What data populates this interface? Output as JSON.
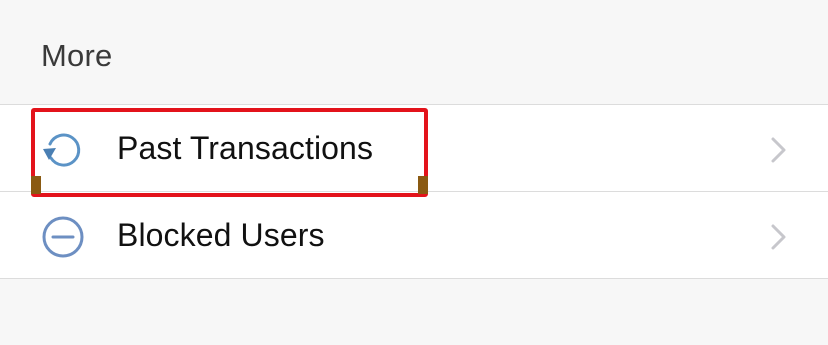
{
  "section": {
    "title": "More"
  },
  "items": [
    {
      "label": "Past Transactions",
      "icon": "history-icon"
    },
    {
      "label": "Blocked Users",
      "icon": "blocked-icon"
    }
  ],
  "colors": {
    "background": "#f7f7f7",
    "icon_blue": "#5b93c6",
    "chevron": "#c7c7cc",
    "highlight": "#e3131b"
  }
}
